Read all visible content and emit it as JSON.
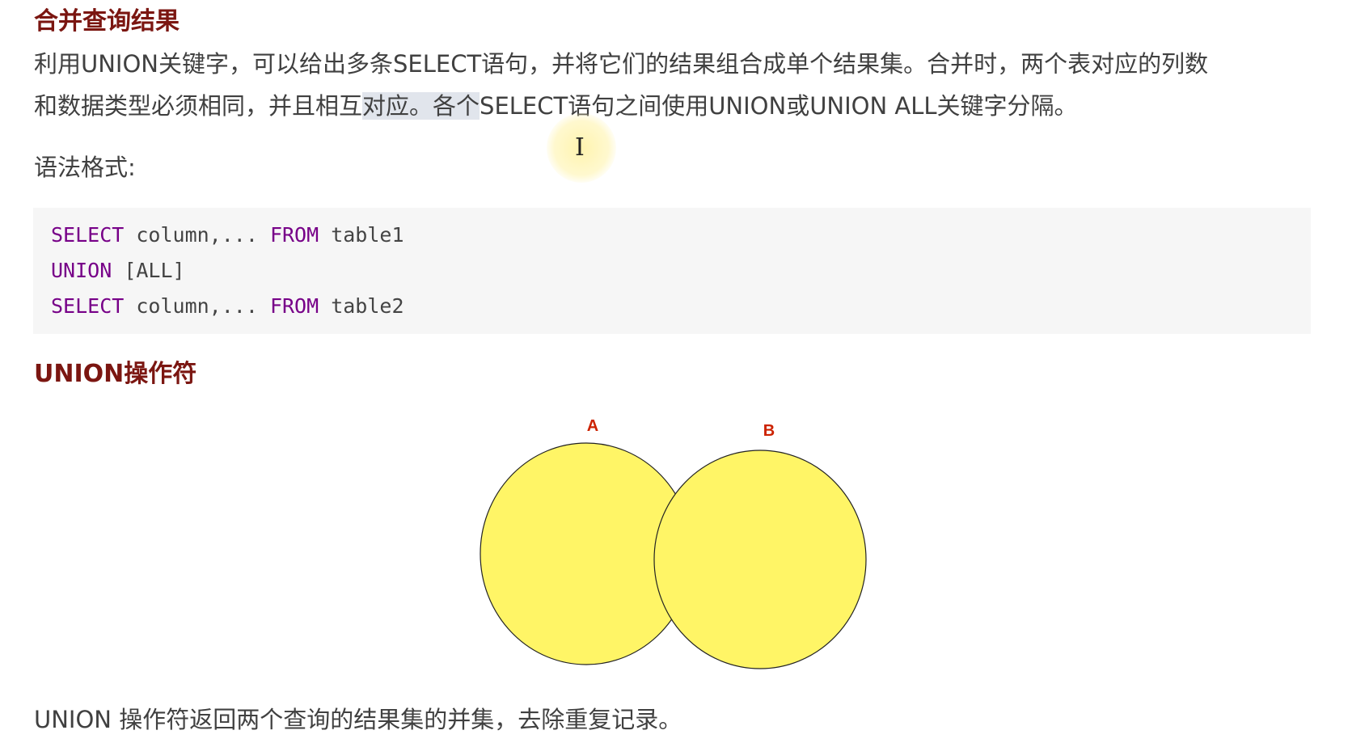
{
  "section": {
    "title": "合并查询结果"
  },
  "intro": {
    "line1": "利用UNION关键字，可以给出多条SELECT语句，并将它们的结果组合成单个结果集。合并时，两个表对应的列数",
    "line2_before": "和数据类型必须相同，并且相互",
    "line2_highlight": "对应。各个",
    "line2_after": "SELECT语句之间使用UNION或UNION ALL关键字分隔。"
  },
  "syntax": {
    "label": "语法格式:"
  },
  "code": {
    "line1_kw1": "SELECT",
    "line1_mid": " column,... ",
    "line1_kw2": "FROM",
    "line1_end": " table1",
    "line2_kw": "UNION",
    "line2_end": " [ALL]",
    "line3_kw1": "SELECT",
    "line3_mid": " column,... ",
    "line3_kw2": "FROM",
    "line3_end": " table2"
  },
  "union_section": {
    "title": "UNION操作符"
  },
  "diagram": {
    "label_a": "A",
    "label_b": "B",
    "fill_color": "#fff566",
    "label_color": "#cc2200"
  },
  "description": {
    "text": "UNION 操作符返回两个查询的结果集的并集，去除重复记录。"
  },
  "cursor": {
    "icon": "text-cursor-icon"
  }
}
